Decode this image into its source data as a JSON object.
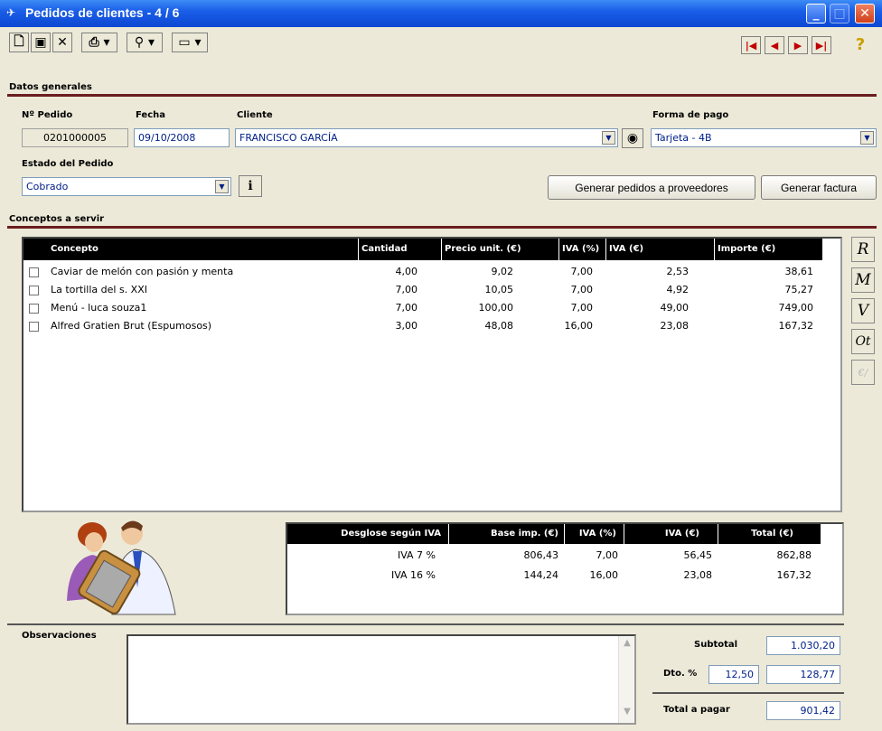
{
  "window": {
    "title": "Pedidos de clientes - 4 / 6"
  },
  "sections": {
    "general": "Datos generales",
    "concepts": "Conceptos a servir",
    "observations": "Observaciones"
  },
  "order": {
    "number_label": "Nº Pedido",
    "number": "0201000005",
    "date_label": "Fecha",
    "date": "09/10/2008",
    "client_label": "Cliente",
    "client": "FRANCISCO GARCÍA",
    "payment_label": "Forma de pago",
    "payment": "Tarjeta - 4B",
    "status_label": "Estado del Pedido",
    "status": "Cobrado"
  },
  "buttons": {
    "generate_orders": "Generar pedidos a proveedores",
    "generate_invoice": "Generar factura"
  },
  "concepts": {
    "headers": [
      "Concepto",
      "Cantidad",
      "Precio unit. (€)",
      "IVA (%)",
      "IVA (€)",
      "Importe (€)"
    ],
    "rows": [
      {
        "concept": "Caviar de melón con pasión y menta",
        "qty": "4,00",
        "price": "9,02",
        "iva_pct": "7,00",
        "iva_eur": "2,53",
        "amount": "38,61"
      },
      {
        "concept": "La tortilla del s. XXI",
        "qty": "7,00",
        "price": "10,05",
        "iva_pct": "7,00",
        "iva_eur": "4,92",
        "amount": "75,27"
      },
      {
        "concept": "Menú - luca souza1",
        "qty": "7,00",
        "price": "100,00",
        "iva_pct": "7,00",
        "iva_eur": "49,00",
        "amount": "749,00"
      },
      {
        "concept": "Alfred Gratien Brut (Espumosos)",
        "qty": "3,00",
        "price": "48,08",
        "iva_pct": "16,00",
        "iva_eur": "23,08",
        "amount": "167,32"
      }
    ]
  },
  "side_buttons": [
    "R",
    "M",
    "V",
    "Ot",
    "€/"
  ],
  "iva_breakdown": {
    "headers": [
      "Desglose según IVA",
      "Base imp. (€)",
      "IVA (%)",
      "IVA (€)",
      "Total (€)"
    ],
    "rows": [
      {
        "label": "IVA 7 %",
        "base": "806,43",
        "pct": "7,00",
        "iva": "56,45",
        "total": "862,88"
      },
      {
        "label": "IVA 16 %",
        "base": "144,24",
        "pct": "16,00",
        "iva": "23,08",
        "total": "167,32"
      }
    ]
  },
  "totals": {
    "subtotal_label": "Subtotal",
    "subtotal": "1.030,20",
    "discount_label": "Dto. %",
    "discount_pct": "12,50",
    "discount_amount": "128,77",
    "total_label": "Total a pagar",
    "total": "901,42"
  }
}
